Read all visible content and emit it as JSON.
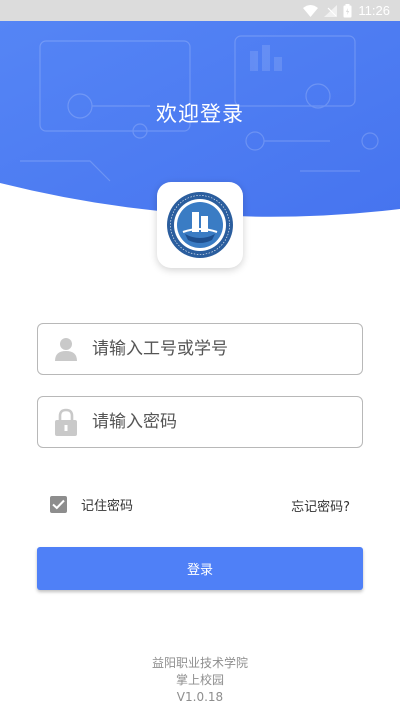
{
  "status_bar": {
    "time": "11:26"
  },
  "header": {
    "title": "欢迎登录"
  },
  "logo": {
    "text": "YIYANG VOCATIONAL & TECHNICAL COLLEGE"
  },
  "form": {
    "username_placeholder": "请输入工号或学号",
    "password_placeholder": "请输入密码",
    "remember_label": "记住密码",
    "remember_checked": true,
    "forgot_label": "忘记密码?"
  },
  "login_button": {
    "label": "登录"
  },
  "footer": {
    "school": "益阳职业技术学院",
    "app": "掌上校园",
    "version": "V1.0.18"
  },
  "colors": {
    "accent": "#4f80f7",
    "hero": "#4c7ef4"
  }
}
